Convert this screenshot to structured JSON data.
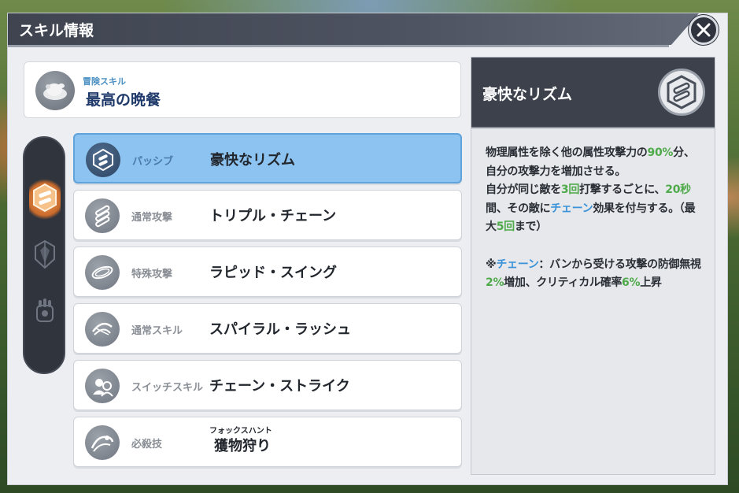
{
  "window": {
    "title": "スキル情報"
  },
  "adventure_skill": {
    "label": "冒険スキル",
    "name": "最高の晩餐"
  },
  "side_tabs": [
    {
      "icon": "chain-skill-icon",
      "active": true
    },
    {
      "icon": "knight-crest-icon",
      "active": false
    },
    {
      "icon": "gauntlet-icon",
      "active": false
    }
  ],
  "skills": [
    {
      "type": "パッシブ",
      "name": "豪快なリズム",
      "selected": true,
      "icon": "chain-rhythm-icon"
    },
    {
      "type": "通常攻撃",
      "name": "トリプル・チェーン",
      "selected": false,
      "icon": "triple-chain-icon"
    },
    {
      "type": "特殊攻撃",
      "name": "ラピッド・スイング",
      "selected": false,
      "icon": "rapid-swing-icon"
    },
    {
      "type": "通常スキル",
      "name": "スパイラル・ラッシュ",
      "selected": false,
      "icon": "spiral-rush-icon"
    },
    {
      "type": "スイッチスキル",
      "name": "チェーン・ストライク",
      "selected": false,
      "icon": "chain-strike-icon"
    },
    {
      "type": "必殺技",
      "name": "獲物狩り",
      "ruby": "フォックスハント",
      "selected": false,
      "icon": "fox-hunt-icon"
    }
  ],
  "detail": {
    "title": "豪快なリズム",
    "p1": {
      "t1": "物理属性を除く他の属性攻撃力の",
      "v1": "90%",
      "t2": "分、自分の攻撃力を増加させる。"
    },
    "p2": {
      "t1": "自分が同じ敵を",
      "v1": "3回",
      "t2": "打撃するごとに、",
      "v2": "20秒",
      "t3": "間、その敵に",
      "k1": "チェーン",
      "t4": "効果を付与する。（最大",
      "v3": "5回",
      "t5": "まで）"
    },
    "note": {
      "prefix": "※",
      "k1": "チェーン",
      "t1": "：バンから受ける攻撃の防御無視",
      "v1": "2%",
      "t2": "増加、クリティカル確率",
      "v2": "6%",
      "t3": "上昇"
    }
  },
  "colors": {
    "accent_blue": "#8cc3f0",
    "highlight_green": "#4faa4a",
    "highlight_blue": "#3a92d8",
    "header_dark": "#3c414c"
  }
}
